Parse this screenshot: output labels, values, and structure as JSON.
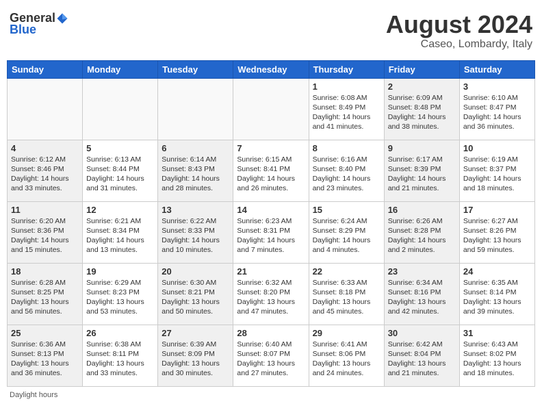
{
  "header": {
    "logo": {
      "text_general": "General",
      "text_blue": "Blue"
    },
    "title": "August 2024",
    "subtitle": "Caseo, Lombardy, Italy"
  },
  "days": [
    "Sunday",
    "Monday",
    "Tuesday",
    "Wednesday",
    "Thursday",
    "Friday",
    "Saturday"
  ],
  "weeks": [
    [
      {
        "day": "",
        "content": "",
        "shaded": false
      },
      {
        "day": "",
        "content": "",
        "shaded": false
      },
      {
        "day": "",
        "content": "",
        "shaded": false
      },
      {
        "day": "",
        "content": "",
        "shaded": false
      },
      {
        "day": "1",
        "content": "Sunrise: 6:08 AM\nSunset: 8:49 PM\nDaylight: 14 hours\nand 41 minutes.",
        "shaded": false
      },
      {
        "day": "2",
        "content": "Sunrise: 6:09 AM\nSunset: 8:48 PM\nDaylight: 14 hours\nand 38 minutes.",
        "shaded": true
      },
      {
        "day": "3",
        "content": "Sunrise: 6:10 AM\nSunset: 8:47 PM\nDaylight: 14 hours\nand 36 minutes.",
        "shaded": false
      }
    ],
    [
      {
        "day": "4",
        "content": "Sunrise: 6:12 AM\nSunset: 8:46 PM\nDaylight: 14 hours\nand 33 minutes.",
        "shaded": true
      },
      {
        "day": "5",
        "content": "Sunrise: 6:13 AM\nSunset: 8:44 PM\nDaylight: 14 hours\nand 31 minutes.",
        "shaded": false
      },
      {
        "day": "6",
        "content": "Sunrise: 6:14 AM\nSunset: 8:43 PM\nDaylight: 14 hours\nand 28 minutes.",
        "shaded": true
      },
      {
        "day": "7",
        "content": "Sunrise: 6:15 AM\nSunset: 8:41 PM\nDaylight: 14 hours\nand 26 minutes.",
        "shaded": false
      },
      {
        "day": "8",
        "content": "Sunrise: 6:16 AM\nSunset: 8:40 PM\nDaylight: 14 hours\nand 23 minutes.",
        "shaded": false
      },
      {
        "day": "9",
        "content": "Sunrise: 6:17 AM\nSunset: 8:39 PM\nDaylight: 14 hours\nand 21 minutes.",
        "shaded": true
      },
      {
        "day": "10",
        "content": "Sunrise: 6:19 AM\nSunset: 8:37 PM\nDaylight: 14 hours\nand 18 minutes.",
        "shaded": false
      }
    ],
    [
      {
        "day": "11",
        "content": "Sunrise: 6:20 AM\nSunset: 8:36 PM\nDaylight: 14 hours\nand 15 minutes.",
        "shaded": true
      },
      {
        "day": "12",
        "content": "Sunrise: 6:21 AM\nSunset: 8:34 PM\nDaylight: 14 hours\nand 13 minutes.",
        "shaded": false
      },
      {
        "day": "13",
        "content": "Sunrise: 6:22 AM\nSunset: 8:33 PM\nDaylight: 14 hours\nand 10 minutes.",
        "shaded": true
      },
      {
        "day": "14",
        "content": "Sunrise: 6:23 AM\nSunset: 8:31 PM\nDaylight: 14 hours\nand 7 minutes.",
        "shaded": false
      },
      {
        "day": "15",
        "content": "Sunrise: 6:24 AM\nSunset: 8:29 PM\nDaylight: 14 hours\nand 4 minutes.",
        "shaded": false
      },
      {
        "day": "16",
        "content": "Sunrise: 6:26 AM\nSunset: 8:28 PM\nDaylight: 14 hours\nand 2 minutes.",
        "shaded": true
      },
      {
        "day": "17",
        "content": "Sunrise: 6:27 AM\nSunset: 8:26 PM\nDaylight: 13 hours\nand 59 minutes.",
        "shaded": false
      }
    ],
    [
      {
        "day": "18",
        "content": "Sunrise: 6:28 AM\nSunset: 8:25 PM\nDaylight: 13 hours\nand 56 minutes.",
        "shaded": true
      },
      {
        "day": "19",
        "content": "Sunrise: 6:29 AM\nSunset: 8:23 PM\nDaylight: 13 hours\nand 53 minutes.",
        "shaded": false
      },
      {
        "day": "20",
        "content": "Sunrise: 6:30 AM\nSunset: 8:21 PM\nDaylight: 13 hours\nand 50 minutes.",
        "shaded": true
      },
      {
        "day": "21",
        "content": "Sunrise: 6:32 AM\nSunset: 8:20 PM\nDaylight: 13 hours\nand 47 minutes.",
        "shaded": false
      },
      {
        "day": "22",
        "content": "Sunrise: 6:33 AM\nSunset: 8:18 PM\nDaylight: 13 hours\nand 45 minutes.",
        "shaded": false
      },
      {
        "day": "23",
        "content": "Sunrise: 6:34 AM\nSunset: 8:16 PM\nDaylight: 13 hours\nand 42 minutes.",
        "shaded": true
      },
      {
        "day": "24",
        "content": "Sunrise: 6:35 AM\nSunset: 8:14 PM\nDaylight: 13 hours\nand 39 minutes.",
        "shaded": false
      }
    ],
    [
      {
        "day": "25",
        "content": "Sunrise: 6:36 AM\nSunset: 8:13 PM\nDaylight: 13 hours\nand 36 minutes.",
        "shaded": true
      },
      {
        "day": "26",
        "content": "Sunrise: 6:38 AM\nSunset: 8:11 PM\nDaylight: 13 hours\nand 33 minutes.",
        "shaded": false
      },
      {
        "day": "27",
        "content": "Sunrise: 6:39 AM\nSunset: 8:09 PM\nDaylight: 13 hours\nand 30 minutes.",
        "shaded": true
      },
      {
        "day": "28",
        "content": "Sunrise: 6:40 AM\nSunset: 8:07 PM\nDaylight: 13 hours\nand 27 minutes.",
        "shaded": false
      },
      {
        "day": "29",
        "content": "Sunrise: 6:41 AM\nSunset: 8:06 PM\nDaylight: 13 hours\nand 24 minutes.",
        "shaded": false
      },
      {
        "day": "30",
        "content": "Sunrise: 6:42 AM\nSunset: 8:04 PM\nDaylight: 13 hours\nand 21 minutes.",
        "shaded": true
      },
      {
        "day": "31",
        "content": "Sunrise: 6:43 AM\nSunset: 8:02 PM\nDaylight: 13 hours\nand 18 minutes.",
        "shaded": false
      }
    ]
  ],
  "footer": "Daylight hours"
}
